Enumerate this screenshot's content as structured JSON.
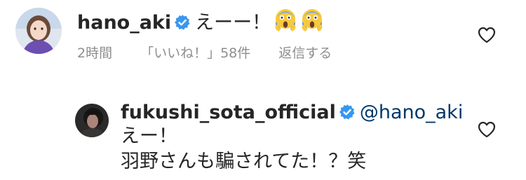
{
  "comment": {
    "username": "hano_aki",
    "text": "えーー！",
    "emoji": [
      "face-screaming-in-fear",
      "face-screaming-in-fear"
    ],
    "time": "2時間",
    "likes": "「いいね！」58件",
    "reply_label": "返信する"
  },
  "reply": {
    "username": "fukushi_sota_official",
    "mention": "@hano_aki",
    "line1": "えー！",
    "line2": "羽野さんも騙されてた！？笑"
  },
  "colors": {
    "text": "#262626",
    "meta": "#8e8e8e",
    "verified": "#3897f0",
    "mention": "#00376b"
  }
}
